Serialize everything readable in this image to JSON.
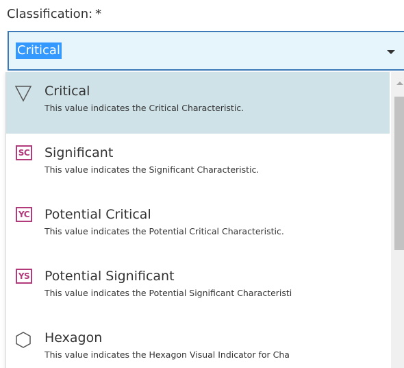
{
  "field": {
    "label": "Classification:",
    "required_marker": "*",
    "selected_value": "Critical"
  },
  "dropdown": {
    "options": [
      {
        "title": "Critical",
        "description": "This value indicates the Critical Characteristic.",
        "icon": "triangle-down-icon",
        "selected": true
      },
      {
        "title": "Significant",
        "description": "This value indicates the Significant Characteristic.",
        "icon": "sc-badge-icon",
        "badge": "SC"
      },
      {
        "title": "Potential Critical",
        "description": "This value indicates the Potential Critical Characteristic.",
        "icon": "yc-badge-icon",
        "badge": "YC"
      },
      {
        "title": "Potential Significant",
        "description": "This value indicates the Potential Significant Characteristi",
        "icon": "ys-badge-icon",
        "badge": "YS"
      },
      {
        "title": "Hexagon",
        "description": "This value indicates the Hexagon Visual Indicator for Cha",
        "icon": "hexagon-icon"
      }
    ]
  },
  "colors": {
    "select_border": "#3b79b8",
    "select_background": "#e6f4fb",
    "text_highlight": "#3399ff",
    "selected_row": "#cfe2e8",
    "badge": "#b23a7a"
  }
}
